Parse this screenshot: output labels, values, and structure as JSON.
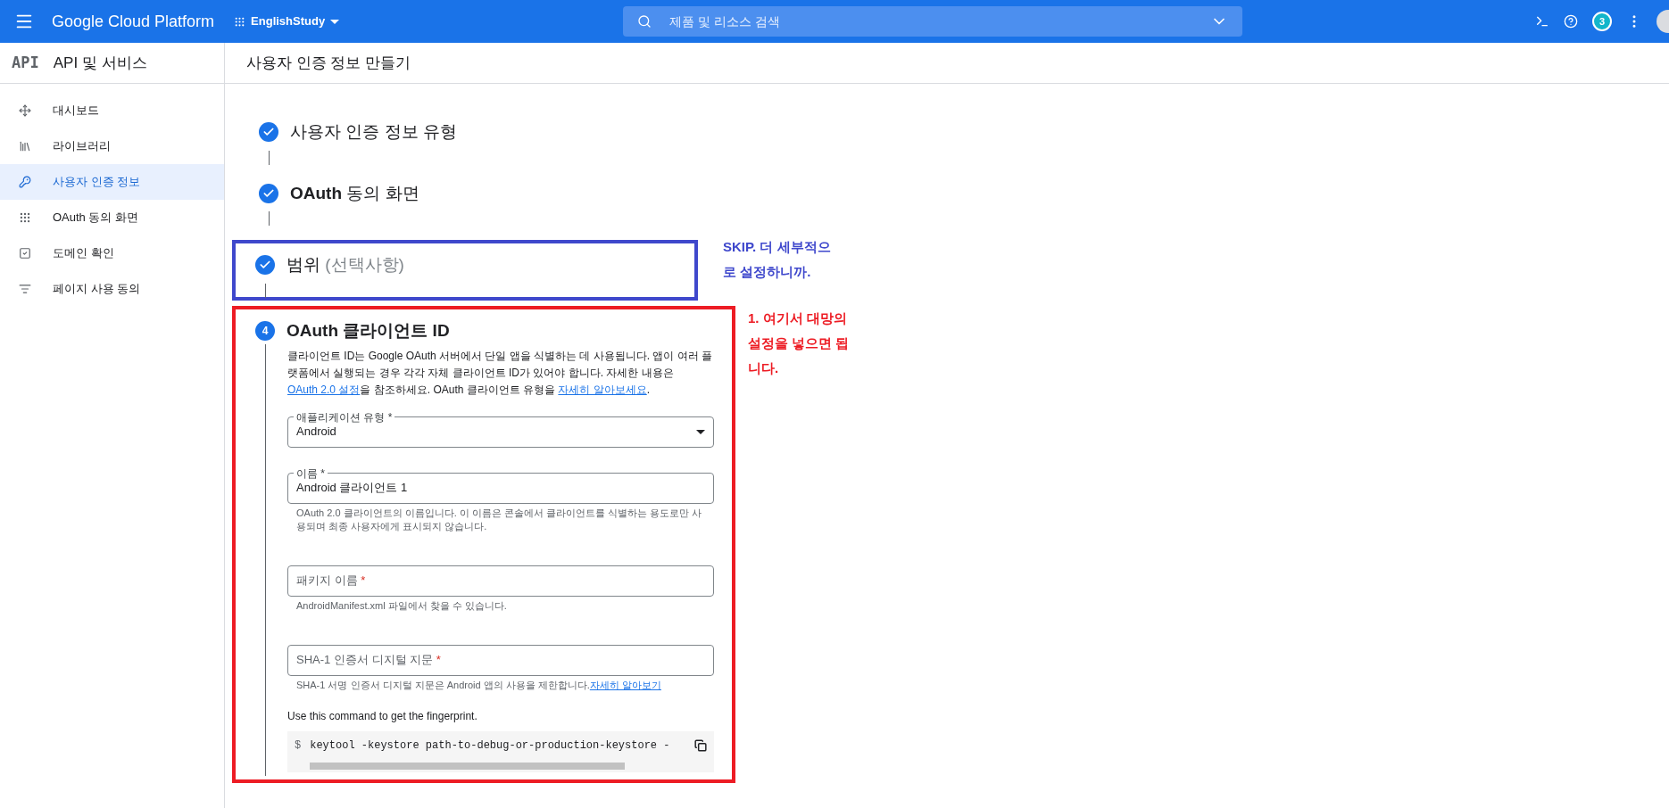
{
  "topbar": {
    "product": "Google Cloud Platform",
    "project": "EnglishStudy",
    "search": {
      "placeholder": "제품 및 리소스 검색"
    },
    "notification_count": "3"
  },
  "sidebar": {
    "logo": "API",
    "title": "API 및 서비스",
    "items": [
      {
        "label": "대시보드",
        "selected": false
      },
      {
        "label": "라이브러리",
        "selected": false
      },
      {
        "label": "사용자 인증 정보",
        "selected": true
      },
      {
        "label": "OAuth 동의 화면",
        "selected": false
      },
      {
        "label": "도메인 확인",
        "selected": false
      },
      {
        "label": "페이지 사용 동의",
        "selected": false
      }
    ]
  },
  "page_title": "사용자 인증 정보 만들기",
  "steps": [
    {
      "completed": true,
      "title": "사용자 인증 정보 유형"
    },
    {
      "completed": true,
      "title": "**OAuth** 동의 화면"
    },
    {
      "completed": true,
      "title": "범위",
      "optional": "(선택사항)",
      "annotation": {
        "text": "SKIP. 더 세부적으로 설정하니까.",
        "color": "#3f48cc"
      }
    },
    {
      "completed": false,
      "number": "4",
      "title": "OAuth 클라이언트 ID",
      "annotation": {
        "text": "1. 여기서 대망의 설정을 넣으면 됩니다.",
        "color": "#ed1c24"
      }
    }
  ],
  "client_form": {
    "description": [
      {
        "kind": "text",
        "text": "클라이언트 ID는 Google OAuth 서버에서 단일 앱을 식별하는 데 사용됩니다. 앱이 여러 플랫폼에서 실행되는 경우 각각 자체 클라이언트 ID가 있어야 합니다. 자세한 내용은 "
      },
      {
        "kind": "link",
        "text": "OAuth 2.0 설정"
      },
      {
        "kind": "text",
        "text": "을 참조하세요. OAuth 클라이언트 유형을 "
      },
      {
        "kind": "link",
        "text": "자세히 알아보세요"
      },
      {
        "kind": "text",
        "text": "."
      }
    ],
    "fields": [
      {
        "kind": "select",
        "label": "애플리케이션 유형 *",
        "value": "Android"
      },
      {
        "kind": "text",
        "label": "이름 *",
        "value": "Android 클라이언트 1",
        "helper": "OAuth 2.0 클라이언트의 이름입니다. 이 이름은 콘솔에서 클라이언트를 식별하는 용도로만 사용되며 최종 사용자에게 표시되지 않습니다."
      },
      {
        "kind": "text",
        "placeholder": "패키지 이름",
        "required_mark": "*",
        "helper": "AndroidManifest.xml 파일에서 찾을 수 있습니다."
      },
      {
        "kind": "text",
        "placeholder": "SHA-1 인증서 디지털 지문",
        "required_mark": "*",
        "helper": "SHA-1 서명 인증서 디지털 지문은 Android 앱의 사용을 제한합니다.",
        "helper_link": "자세히 알아보기"
      }
    ],
    "command_hint": "Use this command to get the fingerprint.",
    "command": {
      "prompt": "$",
      "text": "keytool -keystore path-to-debug-or-production-keystore -"
    }
  }
}
